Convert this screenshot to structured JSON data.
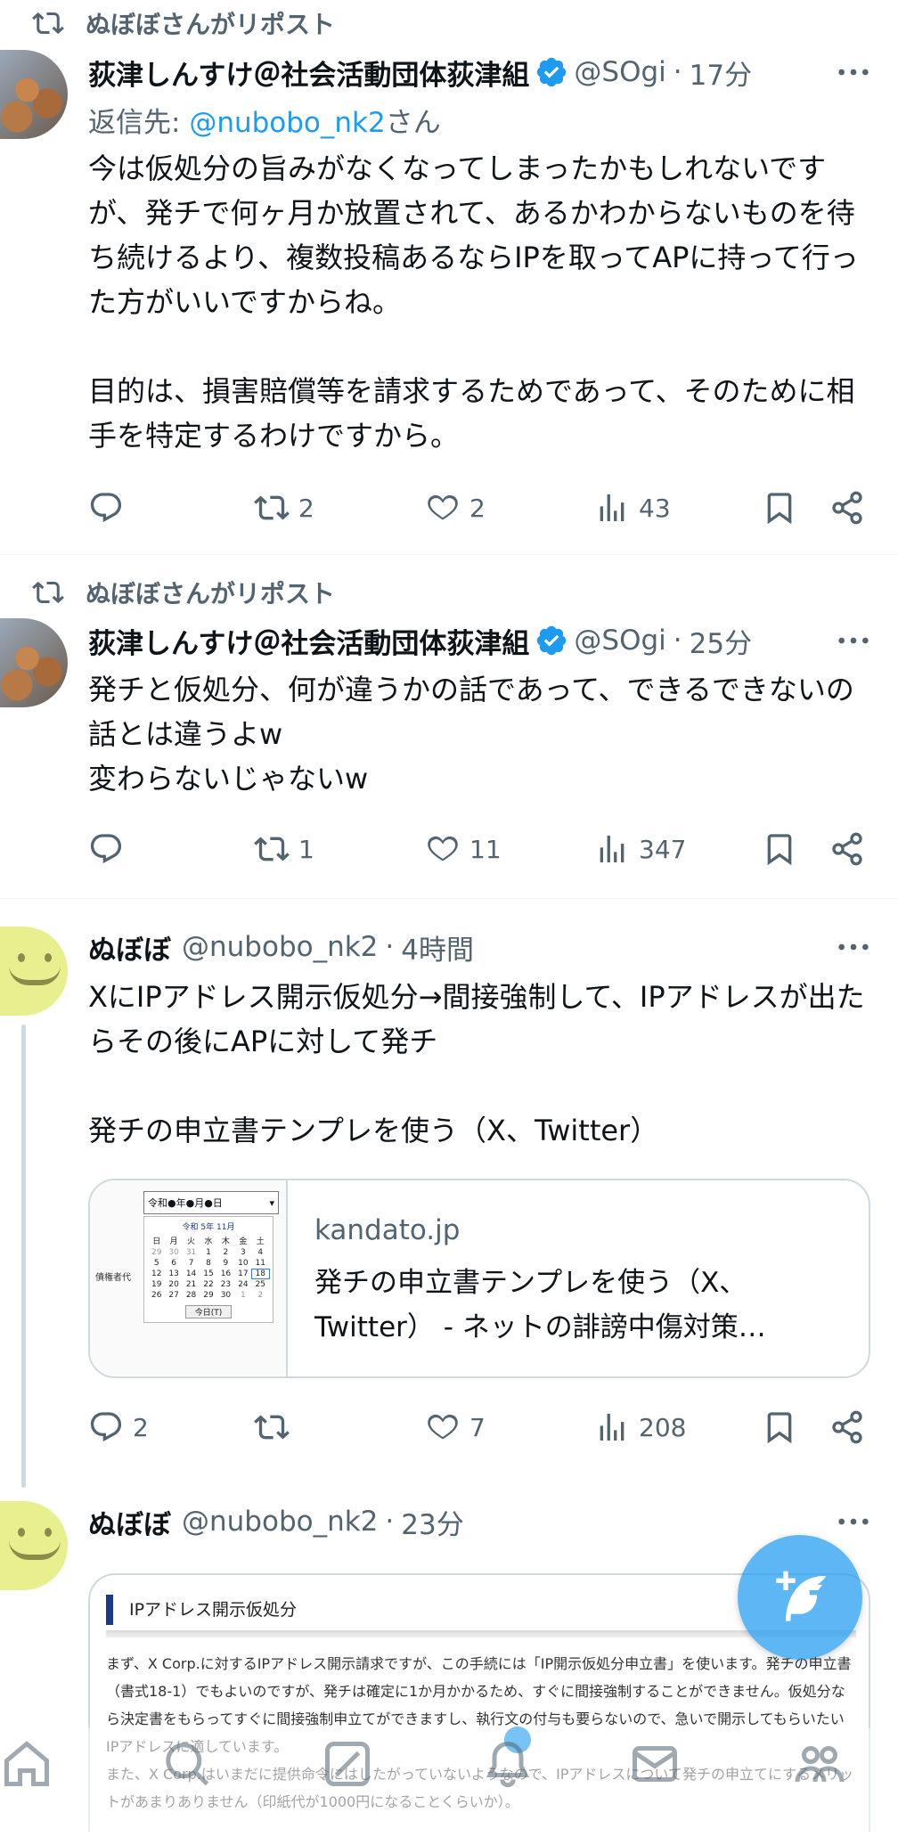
{
  "tweets": [
    {
      "repost_label": "ぬぼぼさんがリポスト",
      "name": "荻津しんすけ＠社会活動団体荻津組",
      "handle": "@SOgi",
      "time": "17分",
      "reply_prefix": "返信先: ",
      "reply_mention": "@nubobo_nk2",
      "reply_suffix": "さん",
      "text": "今は仮処分の旨みがなくなってしまったかもしれないですが、発チで何ヶ月か放置されて、あるかわからないものを待ち続けるより、複数投稿あるならIPを取ってAPに持って行った方がいいですからね。\n\n目的は、損害賠償等を請求するためであって、そのために相手を特定するわけですから。",
      "retweets": "2",
      "likes": "2",
      "views": "43"
    },
    {
      "repost_label": "ぬぼぼさんがリポスト",
      "name": "荻津しんすけ＠社会活動団体荻津組",
      "handle": "@SOgi",
      "time": "25分",
      "text": "発チと仮処分、何が違うかの話であって、できるできないの話とは違うよw\n変わらないじゃないw",
      "retweets": "1",
      "likes": "11",
      "views": "347"
    },
    {
      "name": "ぬぼぼ",
      "handle": "@nubobo_nk2",
      "time": "4時間",
      "text": "XにIPアドレス開示仮処分→間接強制して、IPアドレスが出たらその後にAPに対して発チ\n\n発チの申立書テンプレを使う（X、Twitter）",
      "card": {
        "domain": "kandato.jp",
        "title": "発チの申立書テンプレを使う（X、Twitter） - ネットの誹謗中傷対策…",
        "thumb_input": "令和●年●月●日",
        "thumb_month": "令和 5年 11月",
        "thumb_side": "債権者代",
        "thumb_today": "今日(T)"
      },
      "replies": "2",
      "likes": "7",
      "views": "208"
    },
    {
      "name": "ぬぼぼ",
      "handle": "@nubobo_nk2",
      "time": "23分",
      "doc": {
        "heading": "IPアドレス開示仮処分",
        "text": "まず、X Corp.に対するIPアドレス開示請求ですが、この手続には「IP開示仮処分申立書」を使います。発チの申立書（書式18-1）でもよいのですが、発チは確定に1か月かかるため、すぐに間接強制することができません。仮処分なら決定書をもらってすぐに間接強制申立てができますし、執行文の付与も要らないので、急いで開示してもらいたいIPアドレスに適しています。\nまた、X Corp.はいまだに提供命令にはしたがっていないようなので、IPアドレスについて発チの申立てにするメリットがあまりありません（印紙代が1000円になることくらいか）。"
      }
    }
  ]
}
